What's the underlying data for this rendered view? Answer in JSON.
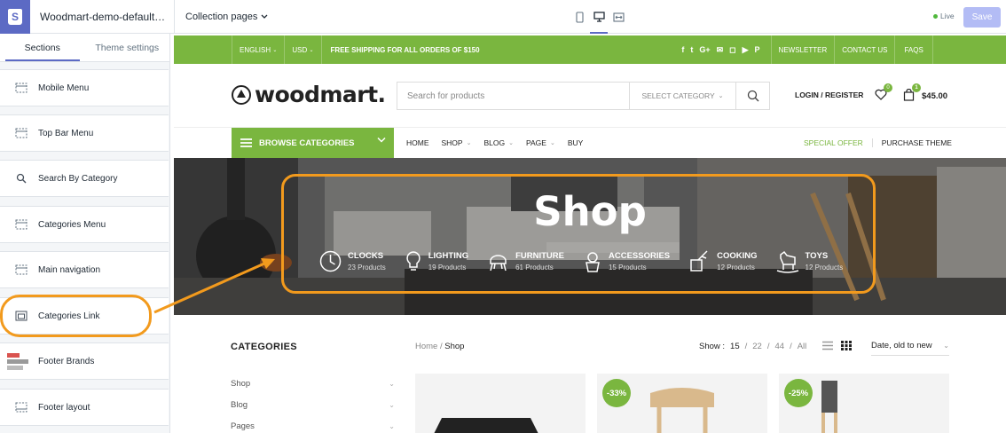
{
  "editor": {
    "store_name": "Woodmart-demo-default-n...",
    "page_selector": "Collection pages",
    "live_label": "Live",
    "save_label": "Save",
    "accent": "#5c6ac4"
  },
  "sidebar": {
    "tabs": [
      {
        "label": "Sections"
      },
      {
        "label": "Theme settings"
      }
    ],
    "items": [
      {
        "label": "Mobile Menu",
        "icon": "layout-icon"
      },
      {
        "label": "Top Bar Menu",
        "icon": "layout-icon"
      },
      {
        "label": "Search By Category",
        "icon": "search-icon"
      },
      {
        "label": "Categories Menu",
        "icon": "layout-icon"
      },
      {
        "label": "Main navigation",
        "icon": "layout-icon"
      },
      {
        "label": "Categories Link",
        "icon": "window-icon"
      },
      {
        "label": "Footer Brands",
        "icon": "brands-thumbnail"
      },
      {
        "label": "Footer layout",
        "icon": "layout-icon"
      }
    ]
  },
  "store": {
    "green": "#7ab63f",
    "topbar": {
      "language": "ENGLISH",
      "currency": "USD",
      "promo": "FREE SHIPPING FOR ALL ORDERS OF $150",
      "social_icons": [
        "facebook-icon",
        "twitter-icon",
        "google-plus-icon",
        "email-icon",
        "instagram-icon",
        "youtube-icon",
        "pinterest-icon"
      ],
      "links": [
        "NEWSLETTER",
        "CONTACT US",
        "FAQS"
      ]
    },
    "header": {
      "brand": "woodmart.",
      "search_placeholder": "Search for products",
      "search_category": "SELECT CATEGORY",
      "login": "LOGIN / REGISTER",
      "wishlist_count": "0",
      "cart_count": "1",
      "cart_total": "$45.00"
    },
    "nav": {
      "browse": "BROWSE CATEGORIES",
      "links": [
        {
          "label": "HOME",
          "dropdown": false
        },
        {
          "label": "SHOP",
          "dropdown": true
        },
        {
          "label": "BLOG",
          "dropdown": true
        },
        {
          "label": "PAGE",
          "dropdown": true
        },
        {
          "label": "BUY",
          "dropdown": false
        }
      ],
      "special": "SPECIAL OFFER",
      "purchase": "PURCHASE THEME"
    },
    "hero": {
      "title": "Shop",
      "categories": [
        {
          "name": "CLOCKS",
          "count": "23 Products",
          "icon": "clock-icon"
        },
        {
          "name": "LIGHTING",
          "count": "19 Products",
          "icon": "bulb-icon"
        },
        {
          "name": "FURNITURE",
          "count": "61 Products",
          "icon": "chair-icon"
        },
        {
          "name": "ACCESSORIES",
          "count": "15 Products",
          "icon": "plant-icon"
        },
        {
          "name": "COOKING",
          "count": "12 Products",
          "icon": "utensils-icon"
        },
        {
          "name": "TOYS",
          "count": "12 Products",
          "icon": "rocking-horse-icon"
        }
      ]
    },
    "listing": {
      "categories_title": "CATEGORIES",
      "categories": [
        "Shop",
        "Blog",
        "Pages"
      ],
      "breadcrumb_home": "Home",
      "breadcrumb_sep": "/",
      "breadcrumb_current": "Shop",
      "show_label": "Show :",
      "show_options": [
        "15",
        "22",
        "44",
        "All"
      ],
      "sort": "Date, old to new",
      "products": [
        {
          "badge": ""
        },
        {
          "badge": "-33%"
        },
        {
          "badge": "-25%"
        }
      ]
    }
  },
  "annotation_color": "#f29a1d"
}
